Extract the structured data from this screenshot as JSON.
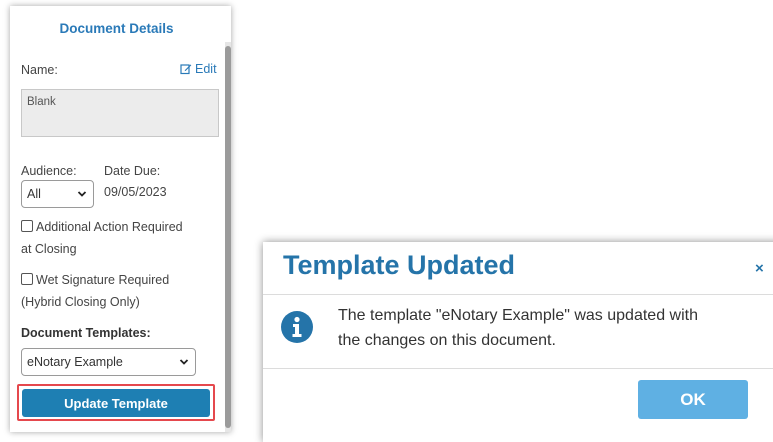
{
  "panel": {
    "title": "Document Details",
    "name_label": "Name:",
    "edit_label": "Edit",
    "name_value": "Blank",
    "audience_label": "Audience:",
    "audience_value": "All",
    "date_due_label": "Date Due:",
    "date_due_value": "09/05/2023",
    "checkbox_additional_line1": "Additional Action Required",
    "checkbox_additional_line2": "at Closing",
    "checkbox_wet_line1": "Wet Signature Required",
    "checkbox_wet_line2": "(Hybrid Closing Only)",
    "templates_label": "Document Templates:",
    "template_value": "eNotary Example",
    "update_button": "Update Template"
  },
  "dialog": {
    "title": "Template Updated",
    "close": "×",
    "message_line1": "The template \"eNotary Example\" was updated with",
    "message_line2": "the changes on this document.",
    "ok_button": "OK"
  },
  "colors": {
    "accent": "#2a7ab8",
    "primary_button": "#1e7fb3",
    "highlight_border": "#e5484d",
    "ok_button": "#5fb0e3"
  },
  "icons": [
    "edit-icon",
    "chevron-down-icon",
    "info-icon",
    "close-icon"
  ]
}
